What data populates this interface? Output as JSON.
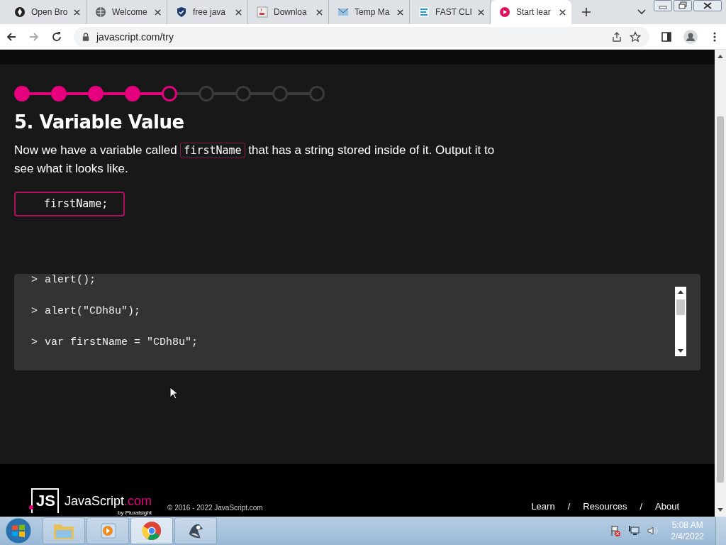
{
  "browser": {
    "tabs": [
      {
        "title": "Open Bro",
        "selected": false
      },
      {
        "title": "Welcome",
        "selected": false
      },
      {
        "title": "free java",
        "selected": false
      },
      {
        "title": "Downloa",
        "selected": false
      },
      {
        "title": "Temp Ma",
        "selected": false
      },
      {
        "title": "FAST CLI",
        "selected": false
      },
      {
        "title": "Start lear",
        "selected": true
      }
    ],
    "url": "javascript.com/try"
  },
  "lesson": {
    "steps": [
      {
        "completed": true,
        "selected": false
      },
      {
        "completed": true,
        "selected": false
      },
      {
        "completed": true,
        "selected": false
      },
      {
        "completed": true,
        "selected": false
      },
      {
        "completed": false,
        "selected": true
      },
      {
        "completed": false,
        "selected": false
      },
      {
        "completed": false,
        "selected": false
      },
      {
        "completed": false,
        "selected": false
      },
      {
        "completed": false,
        "selected": false
      }
    ],
    "title": "5. Variable Value",
    "text_before": "Now we have a variable called",
    "code_word": "firstName",
    "text_after": "that has a string stored inside of it. Output it to see what it looks like.",
    "answer": "firstName;"
  },
  "console": {
    "lines": [
      {
        "prompt": ">",
        "code": "alert();"
      },
      {
        "prompt": ">",
        "code": "alert(\"CDh8u\");"
      },
      {
        "prompt": ">",
        "code": "var firstName = \"CDh8u\";"
      }
    ]
  },
  "footer": {
    "logo_mark": "JS",
    "logo_name": "JavaScript",
    "logo_suffix": ".com",
    "logo_by": "by Pluralsight",
    "copyright": "© 2016 - 2022 JavaScript.com",
    "links": [
      "Learn",
      "Resources",
      "About"
    ],
    "separator": "/"
  },
  "taskbar": {
    "apps": [
      {
        "selected": false
      },
      {
        "selected": false
      },
      {
        "selected": true
      },
      {
        "selected": false
      }
    ],
    "time": "5:08 AM",
    "date": "2/4/2022"
  }
}
